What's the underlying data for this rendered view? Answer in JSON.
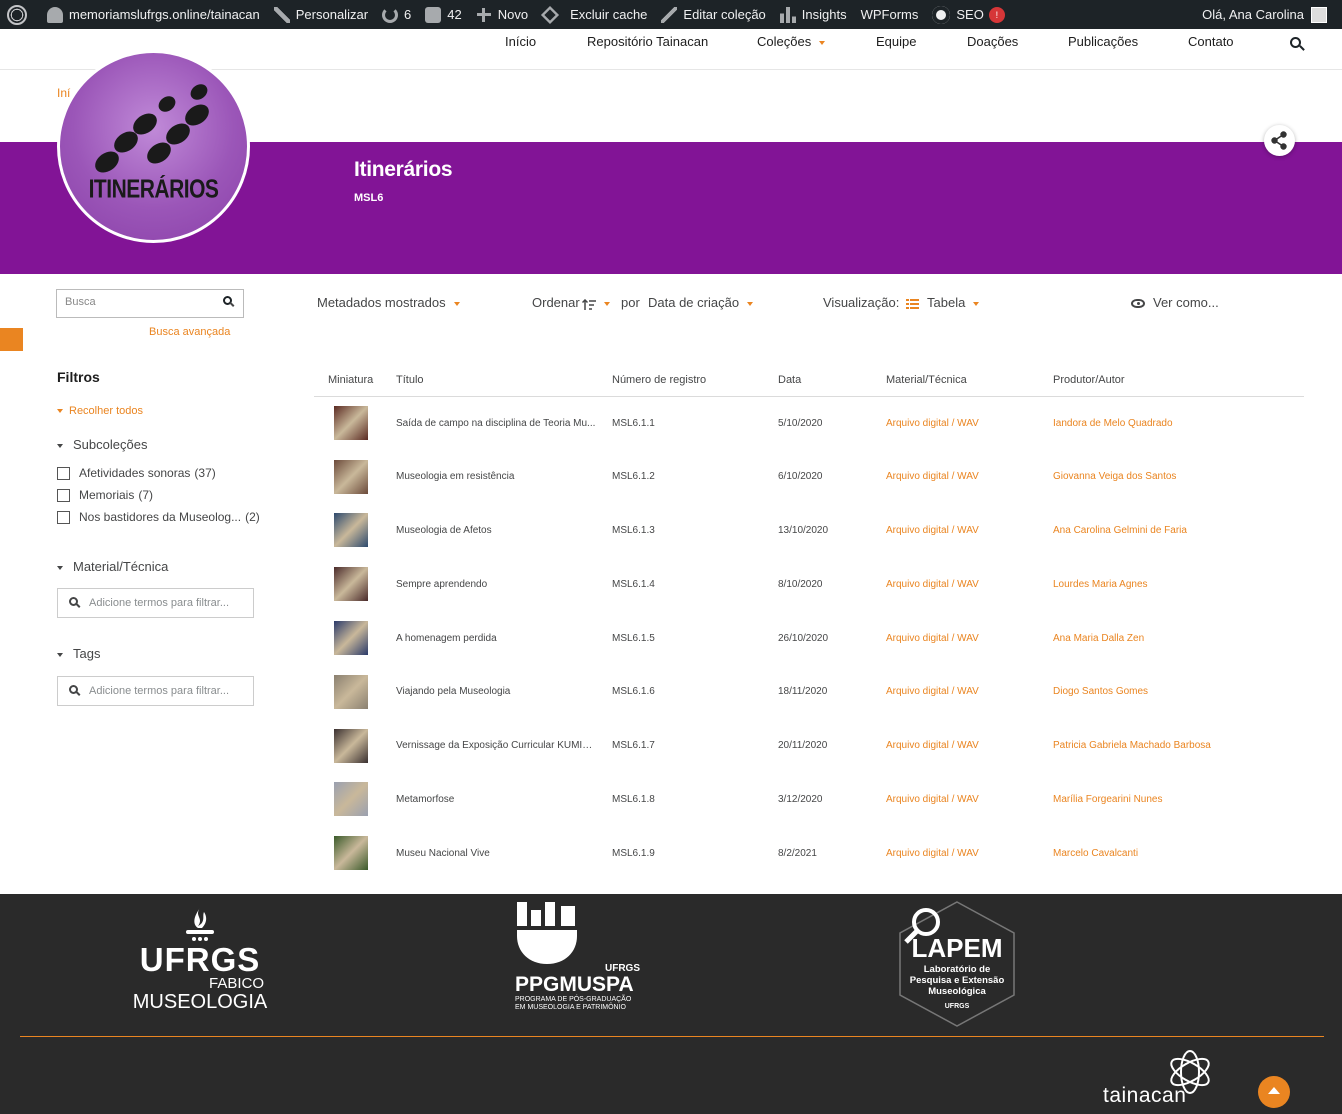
{
  "adminbar": {
    "site": "memoriamslufrgs.online/tainacan",
    "customize": "Personalizar",
    "updates": "6",
    "comments": "42",
    "new": "Novo",
    "cache": "Excluir cache",
    "edit": "Editar coleção",
    "insights": "Insights",
    "wpforms": "WPForms",
    "seo": "SEO",
    "seo_badge": "!",
    "greeting": "Olá, Ana Carolina"
  },
  "nav": {
    "items": [
      "Início",
      "Repositório Tainacan",
      "Coleções",
      "Equipe",
      "Doações",
      "Publicações",
      "Contato"
    ]
  },
  "breadcrumb": "Iní",
  "collection": {
    "title": "Itinerários",
    "subtitle": "MSL6",
    "logo_text": "ITINERÁRIOS",
    "header_color": "#821496"
  },
  "search": {
    "placeholder": "Busca",
    "advanced": "Busca avançada"
  },
  "filters": {
    "title": "Filtros",
    "collapse_all": "Recolher todos",
    "subcollections_label": "Subcoleções",
    "subcollections": [
      {
        "label": "Afetividades sonoras",
        "count": "(37)"
      },
      {
        "label": "Memoriais",
        "count": "(7)"
      },
      {
        "label": "Nos bastidores da Museolog...",
        "count": "(2)"
      }
    ],
    "material_label": "Material/Técnica",
    "material_placeholder": "Adicione termos para filtrar...",
    "tags_label": "Tags",
    "tags_placeholder": "Adicione termos para filtrar..."
  },
  "controls": {
    "metadata": "Metadados mostrados",
    "sort": "Ordenar",
    "by": "por",
    "sort_field": "Data de criação",
    "view_label": "Visualização:",
    "view_mode": "Tabela",
    "view_as": "Ver como..."
  },
  "table": {
    "headers": [
      "Miniatura",
      "Título",
      "Número de registro",
      "Data",
      "Material/Técnica",
      "Produtor/Autor"
    ],
    "rows": [
      {
        "title": "Saída de campo na disciplina de Teoria Mu...",
        "reg": "MSL6.1.1",
        "date": "5/10/2020",
        "material": "Arquivo digital / WAV",
        "author": "Iandora de Melo Quadrado"
      },
      {
        "title": "Museologia em resistência",
        "reg": "MSL6.1.2",
        "date": "6/10/2020",
        "material": "Arquivo digital / WAV",
        "author": "Giovanna Veiga dos Santos"
      },
      {
        "title": "Museologia de Afetos",
        "reg": "MSL6.1.3",
        "date": "13/10/2020",
        "material": "Arquivo digital / WAV",
        "author": "Ana Carolina Gelmini de Faria"
      },
      {
        "title": "Sempre aprendendo",
        "reg": "MSL6.1.4",
        "date": "8/10/2020",
        "material": "Arquivo digital / WAV",
        "author": "Lourdes Maria Agnes"
      },
      {
        "title": "A homenagem perdida",
        "reg": "MSL6.1.5",
        "date": "26/10/2020",
        "material": "Arquivo digital / WAV",
        "author": "Ana Maria Dalla Zen"
      },
      {
        "title": "Viajando pela Museologia",
        "reg": "MSL6.1.6",
        "date": "18/11/2020",
        "material": "Arquivo digital / WAV",
        "author": "Diogo Santos Gomes"
      },
      {
        "title": "Vernissage da Exposição Curricular KUMIAI...",
        "reg": "MSL6.1.7",
        "date": "20/11/2020",
        "material": "Arquivo digital / WAV",
        "author": "Patricia Gabriela Machado Barbosa"
      },
      {
        "title": "Metamorfose",
        "reg": "MSL6.1.8",
        "date": "3/12/2020",
        "material": "Arquivo digital / WAV",
        "author": "Marília Forgearini Nunes"
      },
      {
        "title": "Museu Nacional Vive",
        "reg": "MSL6.1.9",
        "date": "8/2/2021",
        "material": "Arquivo digital / WAV",
        "author": "Marcelo Cavalcanti"
      }
    ],
    "thumb_colors": [
      "#5a2a22",
      "#6b4a3a",
      "#2d4a6e",
      "#4a2a2a",
      "#2a3a6a",
      "#8a8070",
      "#3a3030",
      "#9aa0b0",
      "#3a5a2a"
    ]
  },
  "footer": {
    "ufrgs": "UFRGS",
    "ufrgs_sub1": "FABICO",
    "ufrgs_sub2": "MUSEOLOGIA",
    "ppg_top": "UFRGS",
    "ppg": "PPGMUSPA",
    "ppg_sub1": "PROGRAMA DE PÓS-GRADUAÇÃO",
    "ppg_sub2": "EM MUSEOLOGIA E PATRIMÔNIO",
    "lapem": "LAPEM",
    "lapem_sub1": "Laboratório de",
    "lapem_sub2": "Pesquisa e Extensão",
    "lapem_sub3": "Museológica",
    "lapem_sub4": "UFRGS",
    "tainacan": "tainacan",
    "accent": "#ea8521"
  }
}
